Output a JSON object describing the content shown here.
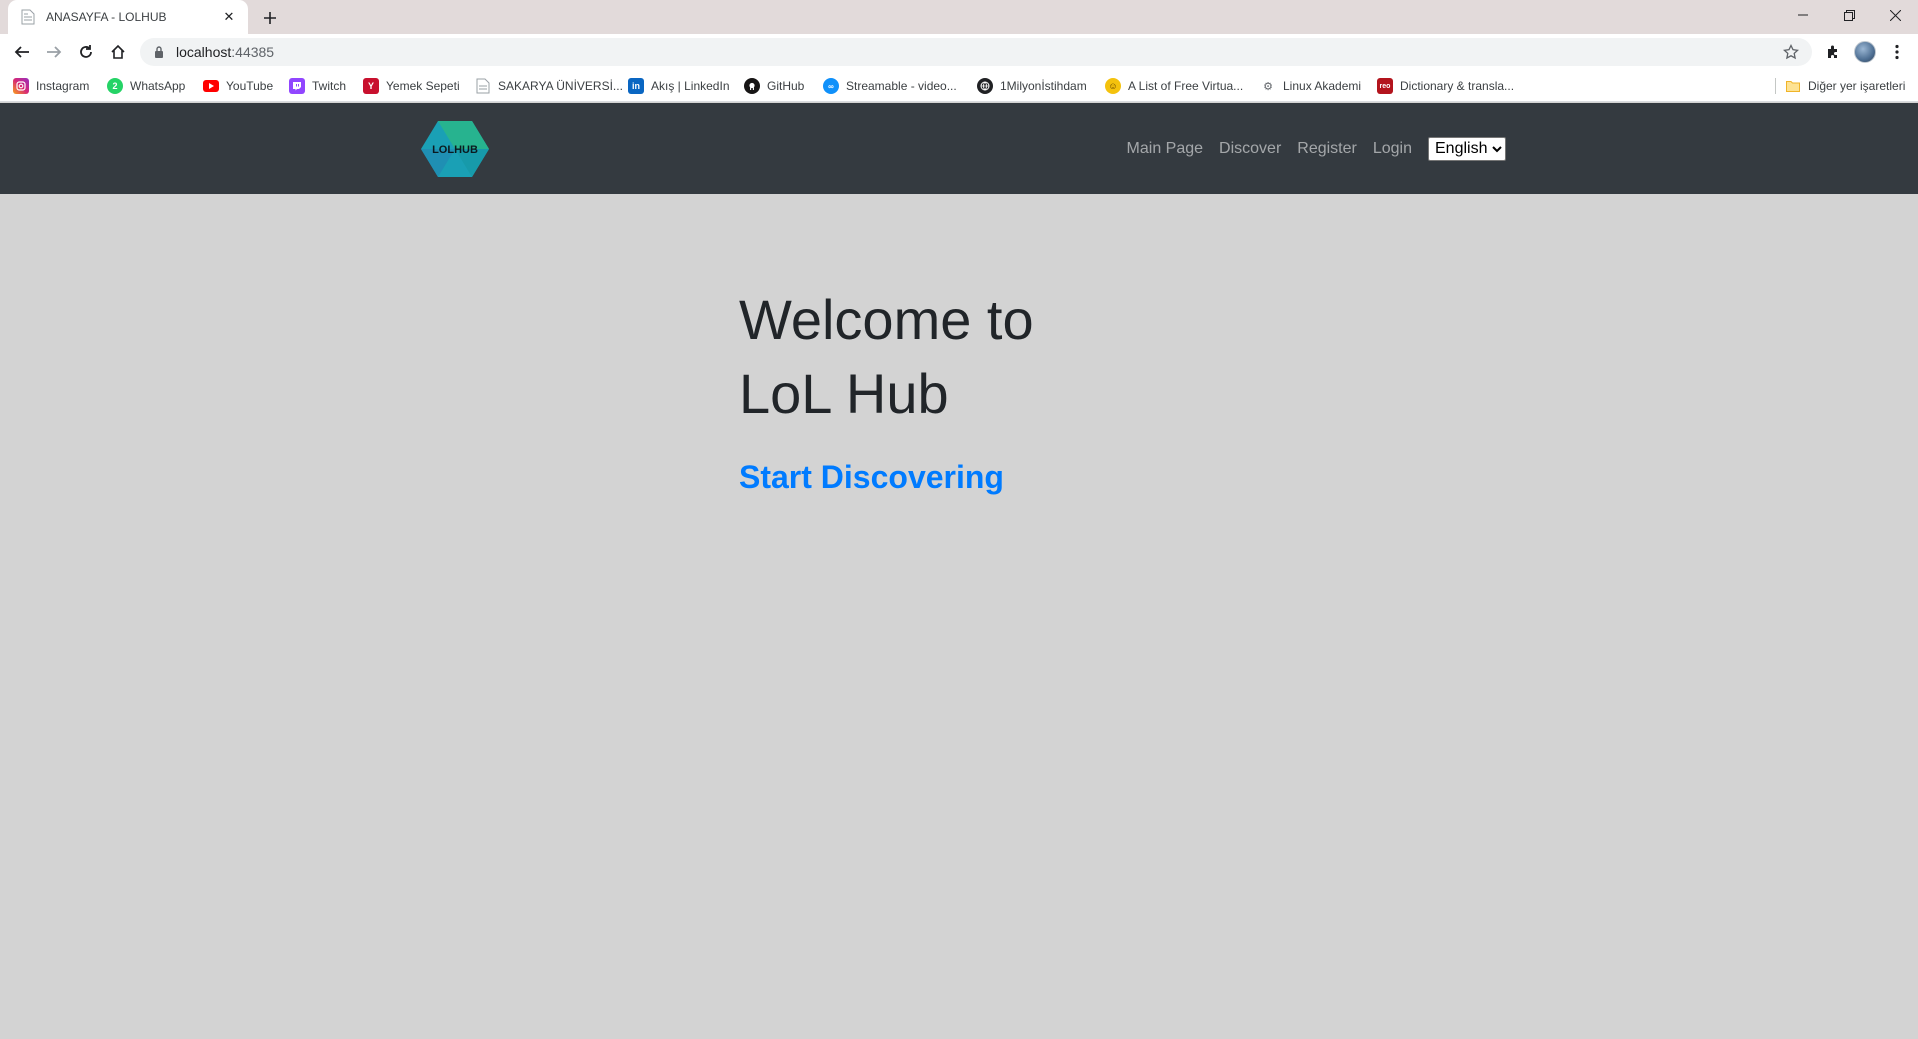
{
  "browser": {
    "tab_title": "ANASAYFA - LOLHUB",
    "url_host": "localhost",
    "url_port": ":44385"
  },
  "bookmarks": [
    {
      "label": "Instagram",
      "icon": "instagram-icon",
      "color": "#d62976"
    },
    {
      "label": "WhatsApp",
      "icon": "whatsapp-icon",
      "color": "#25d366"
    },
    {
      "label": "YouTube",
      "icon": "youtube-icon",
      "color": "#ff0000"
    },
    {
      "label": "Twitch",
      "icon": "twitch-icon",
      "color": "#9146ff"
    },
    {
      "label": "Yemek Sepeti",
      "icon": "yemeksepeti-icon",
      "color": "#c8102e"
    },
    {
      "label": "SAKARYA ÜNİVERSİ...",
      "icon": "page-icon",
      "color": "#9aa0a6"
    },
    {
      "label": "Akış | LinkedIn",
      "icon": "linkedin-icon",
      "color": "#0a66c2"
    },
    {
      "label": "GitHub",
      "icon": "github-icon",
      "color": "#171515"
    },
    {
      "label": "Streamable - video...",
      "icon": "streamable-icon",
      "color": "#0f90fa"
    },
    {
      "label": "1Milyonİstihdam",
      "icon": "globe-icon",
      "color": "#202124"
    },
    {
      "label": "A List of Free Virtua...",
      "icon": "emoji-icon",
      "color": "#f4c20d"
    },
    {
      "label": "Linux Akademi",
      "icon": "linux-icon",
      "color": "#5f6368"
    },
    {
      "label": "Dictionary & transla...",
      "icon": "dictionary-icon",
      "color": "#b3141d"
    }
  ],
  "other_bookmarks": "Diğer yer işaretleri",
  "site": {
    "logo_text": "LOLHUB",
    "nav": [
      "Main Page",
      "Discover",
      "Register",
      "Login"
    ],
    "language_selected": "English",
    "hero_line1": "Welcome to",
    "hero_line2": "LoL Hub",
    "cta": "Start Discovering"
  },
  "colors": {
    "navbar": "#343a40",
    "page_bg": "#d3d3d3",
    "link": "#007bff"
  }
}
